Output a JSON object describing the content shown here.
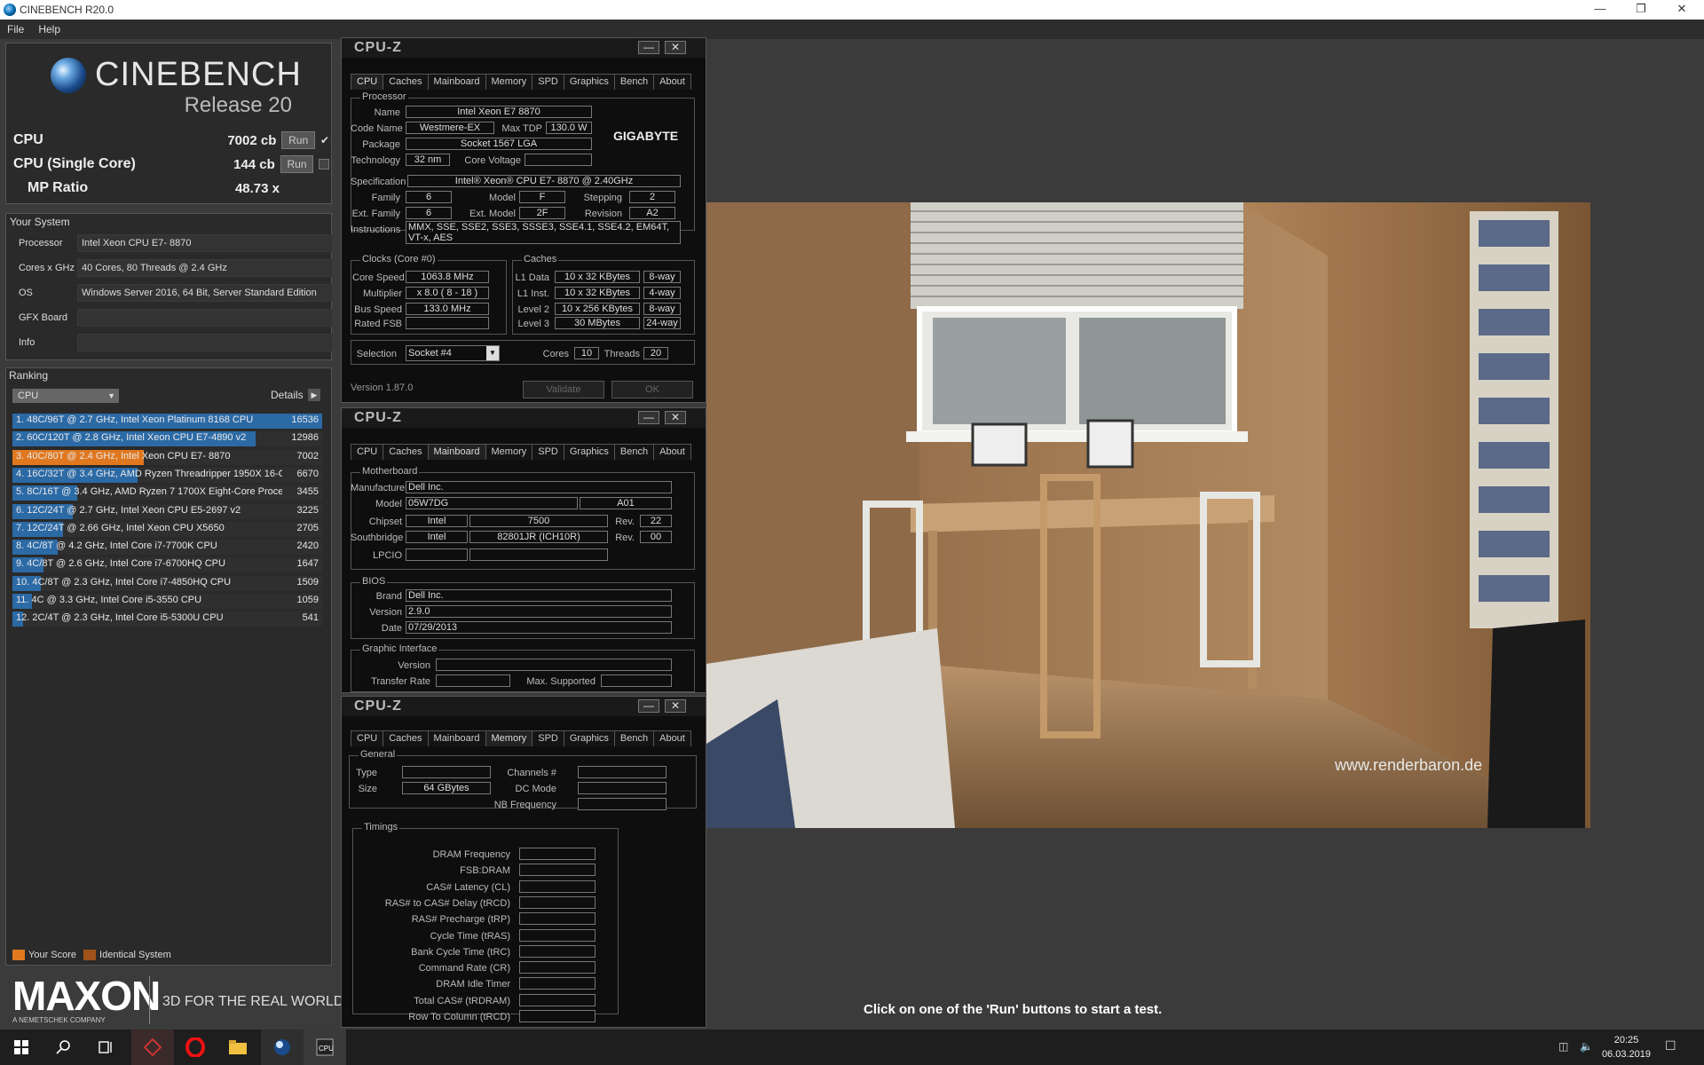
{
  "window": {
    "title": "CINEBENCH R20.0"
  },
  "menu": [
    "File",
    "Help"
  ],
  "cinebench": {
    "brand": "CINEBENCH",
    "release": "Release 20",
    "scores": [
      {
        "label": "CPU",
        "value": "7002 cb",
        "run": "Run",
        "checked": true
      },
      {
        "label": "CPU (Single Core)",
        "value": "144 cb",
        "run": "Run",
        "checked": false
      }
    ],
    "mp_ratio": {
      "label": "MP Ratio",
      "value": "48.73 x"
    },
    "system_title": "Your System",
    "system": [
      {
        "k": "Processor",
        "v": "Intel Xeon CPU E7- 8870"
      },
      {
        "k": "Cores x GHz",
        "v": "40 Cores, 80 Threads @ 2.4 GHz"
      },
      {
        "k": "OS",
        "v": "Windows Server 2016, 64 Bit, Server Standard Edition"
      },
      {
        "k": "GFX Board",
        "v": ""
      },
      {
        "k": "Info",
        "v": ""
      }
    ],
    "ranking_title": "Ranking",
    "ranking_dropdown": "CPU",
    "details_label": "Details",
    "ranking": [
      {
        "text": "1. 48C/96T @ 2.7 GHz, Intel Xeon Platinum 8168 CPU",
        "score": "16536",
        "frac": 1.0,
        "color": "#2c6aa6"
      },
      {
        "text": "2. 60C/120T @ 2.8 GHz, Intel Xeon CPU E7-4890 v2",
        "score": "12986",
        "frac": 0.785,
        "color": "#2c6aa6"
      },
      {
        "text": "3. 40C/80T @ 2.4 GHz, Intel Xeon CPU E7- 8870",
        "score": "7002",
        "frac": 0.423,
        "color": "#e07820"
      },
      {
        "text": "4. 16C/32T @ 3.4 GHz, AMD Ryzen Threadripper 1950X 16-C",
        "score": "6670",
        "frac": 0.403,
        "color": "#2c6aa6"
      },
      {
        "text": "5. 8C/16T @ 3.4 GHz, AMD Ryzen 7 1700X Eight-Core Proces",
        "score": "3455",
        "frac": 0.209,
        "color": "#2c6aa6"
      },
      {
        "text": "6. 12C/24T @ 2.7 GHz, Intel Xeon CPU E5-2697 v2",
        "score": "3225",
        "frac": 0.195,
        "color": "#2c6aa6"
      },
      {
        "text": "7. 12C/24T @ 2.66 GHz, Intel Xeon CPU X5650",
        "score": "2705",
        "frac": 0.164,
        "color": "#2c6aa6"
      },
      {
        "text": "8. 4C/8T @ 4.2 GHz, Intel Core i7-7700K CPU",
        "score": "2420",
        "frac": 0.146,
        "color": "#2c6aa6"
      },
      {
        "text": "9. 4C/8T @ 2.6 GHz, Intel Core i7-6700HQ CPU",
        "score": "1647",
        "frac": 0.1,
        "color": "#2c6aa6"
      },
      {
        "text": "10. 4C/8T @ 2.3 GHz, Intel Core i7-4850HQ CPU",
        "score": "1509",
        "frac": 0.091,
        "color": "#2c6aa6"
      },
      {
        "text": "11. 4C @ 3.3 GHz, Intel Core i5-3550 CPU",
        "score": "1059",
        "frac": 0.064,
        "color": "#2c6aa6"
      },
      {
        "text": "12. 2C/4T @ 2.3 GHz, Intel Core i5-5300U CPU",
        "score": "541",
        "frac": 0.033,
        "color": "#2c6aa6"
      }
    ],
    "legend": [
      {
        "label": "Your Score",
        "color": "#e07820"
      },
      {
        "label": "Identical System",
        "color": "#a0521a"
      }
    ],
    "maxon": "MAXON",
    "maxon_sub": "A NEMETSCHEK COMPANY",
    "tagline": "3D FOR THE REAL WORLD",
    "instruction": "Click on one of the 'Run' buttons to start a test."
  },
  "cpuz": {
    "title": "CPU-Z",
    "tabs": [
      "CPU",
      "Caches",
      "Mainboard",
      "Memory",
      "SPD",
      "Graphics",
      "Bench",
      "About"
    ],
    "cpu": {
      "processor_title": "Processor",
      "name_l": "Name",
      "name": "Intel Xeon E7 8870",
      "code_l": "Code Name",
      "code": "Westmere-EX",
      "tdp_l": "Max TDP",
      "tdp": "130.0 W",
      "package_l": "Package",
      "package": "Socket 1567 LGA",
      "tech_l": "Technology",
      "tech": "32 nm",
      "volt_l": "Core Voltage",
      "volt": "",
      "brand": "GIGABYTE",
      "spec_l": "Specification",
      "spec": "Intel® Xeon® CPU E7- 8870  @ 2.40GHz",
      "family_l": "Family",
      "family": "6",
      "model_l": "Model",
      "model": "F",
      "stepping_l": "Stepping",
      "stepping": "2",
      "extfam_l": "Ext. Family",
      "extfam": "6",
      "extmodel_l": "Ext. Model",
      "extmodel": "2F",
      "revision_l": "Revision",
      "revision": "A2",
      "instr_l": "Instructions",
      "instr": "MMX, SSE, SSE2, SSE3, SSSE3, SSE4.1, SSE4.2, EM64T, VT-x, AES",
      "clocks_title": "Clocks (Core #0)",
      "speed_l": "Core Speed",
      "speed": "1063.8 MHz",
      "mult_l": "Multiplier",
      "mult": "x 8.0  ( 8 - 18 )",
      "bus_l": "Bus Speed",
      "bus": "133.0 MHz",
      "fsb_l": "Rated FSB",
      "fsb": "",
      "caches_title": "Caches",
      "l1d_l": "L1 Data",
      "l1d": "10 x 32 KBytes",
      "l1d_w": "8-way",
      "l1i_l": "L1 Inst.",
      "l1i": "10 x 32 KBytes",
      "l1i_w": "4-way",
      "l2_l": "Level 2",
      "l2": "10 x 256 KBytes",
      "l2_w": "8-way",
      "l3_l": "Level 3",
      "l3": "30 MBytes",
      "l3_w": "24-way",
      "sel_l": "Selection",
      "sel": "Socket #4",
      "cores_l": "Cores",
      "cores": "10",
      "threads_l": "Threads",
      "threads": "20",
      "version": "Version 1.87.0",
      "validate": "Validate",
      "ok": "OK"
    },
    "mb": {
      "mb_title": "Motherboard",
      "manu_l": "Manufacturer",
      "manu": "Dell Inc.",
      "model_l": "Model",
      "model": "05W7DG",
      "model_rev": "A01",
      "chip_l": "Chipset",
      "chip": "Intel",
      "chip2": "7500",
      "chip_rev_l": "Rev.",
      "chip_rev": "22",
      "south_l": "Southbridge",
      "south": "Intel",
      "south2": "82801JR (ICH10R)",
      "south_rev_l": "Rev.",
      "south_rev": "00",
      "lpcio_l": "LPCIO",
      "bios_title": "BIOS",
      "brand_l": "Brand",
      "brand": "Dell Inc.",
      "ver_l": "Version",
      "ver": "2.9.0",
      "date_l": "Date",
      "date": "07/29/2013",
      "gi_title": "Graphic Interface",
      "giver_l": "Version",
      "tr_l": "Transfer Rate",
      "max_l": "Max. Supported"
    },
    "mem": {
      "gen_title": "General",
      "type_l": "Type",
      "type": "",
      "size_l": "Size",
      "size": "64 GBytes",
      "ch_l": "Channels #",
      "dc_l": "DC Mode",
      "nb_l": "NB Frequency",
      "tim_title": "Timings",
      "timings": [
        "DRAM Frequency",
        "FSB:DRAM",
        "CAS# Latency (CL)",
        "RAS# to CAS# Delay (tRCD)",
        "RAS# Precharge (tRP)",
        "Cycle Time (tRAS)",
        "Bank Cycle Time (tRC)",
        "Command Rate (CR)",
        "DRAM Idle Timer",
        "Total CAS# (tRDRAM)",
        "Row To Column (tRCD)"
      ]
    }
  },
  "render": {
    "watermark": "www.renderbaron.de"
  },
  "taskbar": {
    "time": "20:25",
    "date": "06.03.2019"
  }
}
